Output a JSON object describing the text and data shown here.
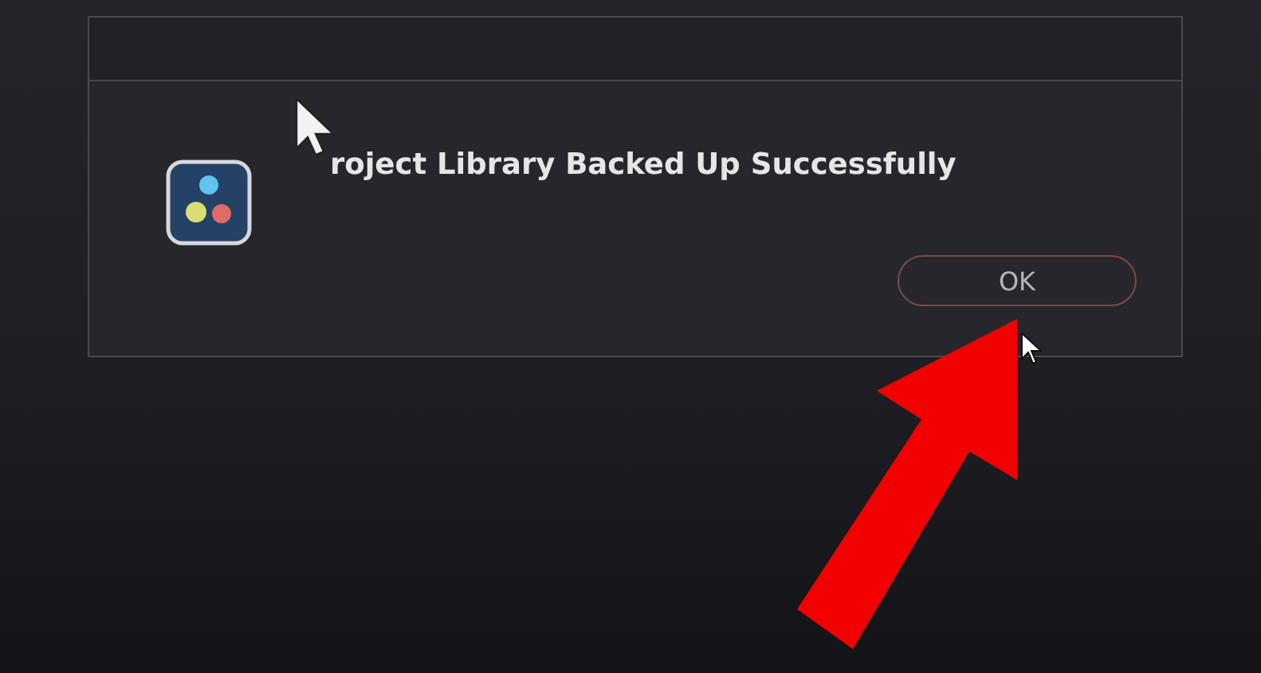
{
  "dialog": {
    "message": "roject Library Backed Up Successfully",
    "buttons": [
      {
        "label": "OK",
        "selected": true
      }
    ]
  }
}
